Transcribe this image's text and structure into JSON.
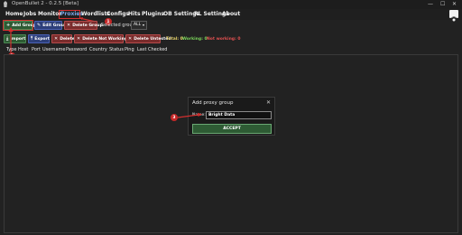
{
  "window": {
    "title": "OpenBullet 2 - 0.2.5 [Beta]",
    "minimize": "—",
    "maximize": "☐",
    "close": "✕"
  },
  "menu": {
    "items": [
      {
        "id": "home",
        "label": "Home"
      },
      {
        "id": "jobs",
        "label": "Jobs"
      },
      {
        "id": "monitor",
        "label": "Monitor"
      },
      {
        "id": "proxies",
        "label": "Proxies",
        "active": true
      },
      {
        "id": "wordlists",
        "label": "Wordlists"
      },
      {
        "id": "configs",
        "label": "Configs"
      },
      {
        "id": "hits",
        "label": "Hits"
      },
      {
        "id": "plugins",
        "label": "Plugins"
      },
      {
        "id": "ob-settings",
        "label": "OB Settings"
      },
      {
        "id": "rl-settings",
        "label": "RL Settings"
      },
      {
        "id": "about",
        "label": "About"
      }
    ]
  },
  "group_toolbar": {
    "add_group": "Add Group",
    "edit_group": "Edit Group",
    "delete_group": "Delete Group",
    "selected_group_label": "Selected group",
    "selected_group_value": "ALL"
  },
  "proxy_toolbar": {
    "import": "Import",
    "export": "Export",
    "delete": "Delete",
    "delete_not_working": "Delete Not Working",
    "delete_untested": "Delete Untested"
  },
  "stats": {
    "total": "Total: 0",
    "working": "Working: 0",
    "not_working": "Not working: 0"
  },
  "table": {
    "columns": [
      "Type",
      "Host",
      "Port",
      "Username",
      "Password",
      "Country",
      "Status",
      "Ping",
      "Last Checked"
    ]
  },
  "callouts": {
    "one": "1",
    "two": "2",
    "three": "3"
  },
  "dialog": {
    "title": "Add proxy group",
    "close": "✕",
    "name_label": "Name:",
    "name_value": "Bright Data",
    "accept": "ACCEPT"
  },
  "colors": {
    "background": "#222222",
    "accent_green": "#2e5b34",
    "accent_blue": "#2d3f7a",
    "accent_red": "#7a2c2c",
    "callout_red": "#c62828",
    "working_green": "#7ad35a",
    "not_working_red": "#e05050",
    "total_yellow": "#e8d36a"
  }
}
